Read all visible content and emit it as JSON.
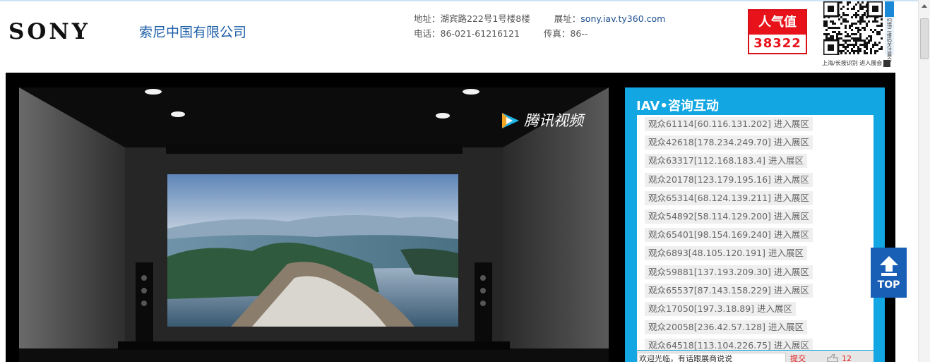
{
  "header": {
    "brand": "SONY",
    "company_name": "索尼中国有限公司",
    "address": "地址：湖宾路222号1号楼8楼",
    "booth_label": "展址：",
    "booth_url": "sony.iav.ty360.com",
    "phone": "电话：86-021-61216121",
    "fax": "传真：86--",
    "popularity_label": "人气值",
    "popularity_value": "38322",
    "qr_side_text": "扫描二维码关注展会",
    "qr_caption": "上海/长按识别 进入展会"
  },
  "video": {
    "platform_name": "腾讯视频"
  },
  "chat_panel": {
    "title": "IAV•咨询互动",
    "visitors": [
      {
        "name": "观众61114[60.116.131.202] 进入展区"
      },
      {
        "name": "观众42618[178.234.249.70] 进入展区"
      },
      {
        "name": "观众63317[112.168.183.4] 进入展区"
      },
      {
        "name": "观众20178[123.179.195.16] 进入展区"
      },
      {
        "name": "观众65314[68.124.139.211] 进入展区"
      },
      {
        "name": "观众54892[58.114.129.200] 进入展区"
      },
      {
        "name": "观众65401[98.154.169.240] 进入展区"
      },
      {
        "name": "观众6893[48.105.120.191] 进入展区"
      },
      {
        "name": "观众59881[137.193.209.30] 进入展区"
      },
      {
        "name": "观众65537[87.143.158.229] 进入展区"
      },
      {
        "name": "观众17050[197.3.18.89] 进入展区"
      },
      {
        "name": "观众20058[236.42.57.128] 进入展区"
      },
      {
        "name": "观众64518[113.104.226.75] 进入展区"
      }
    ],
    "input_value": "欢迎光临，有话跟展商说说",
    "submit_label": "提交",
    "like_count": "12"
  },
  "back_to_top_label": "TOP",
  "colors": {
    "panel_blue": "#12a6e2",
    "popularity_red": "#e8121b",
    "top_button_blue": "#1a5fb6",
    "company_blue": "#1d5fa8"
  }
}
